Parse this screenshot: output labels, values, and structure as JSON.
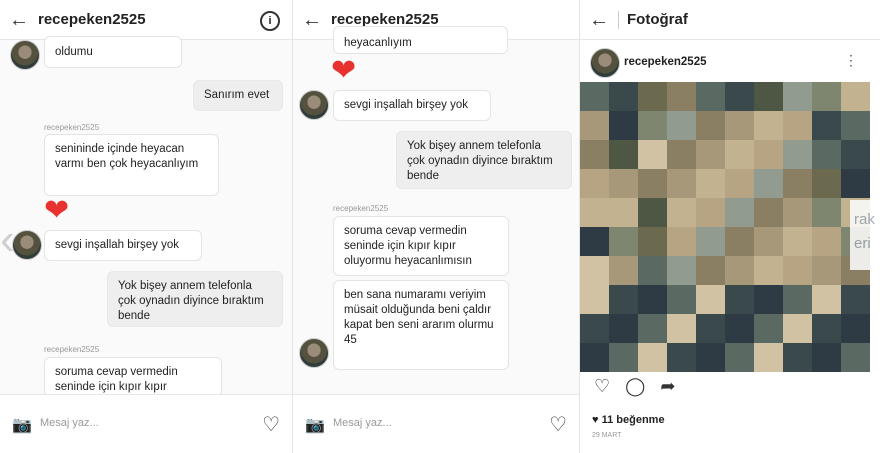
{
  "panel1": {
    "header": {
      "title": "recepeken2525"
    },
    "messages": [
      {
        "text": "oldumu"
      },
      {
        "text": "Sanırım evet"
      },
      {
        "username": "recepeken2525"
      },
      {
        "text": "senininde içinde heyacan varmı ben çok heyacanlıyım"
      },
      {
        "text": "sevgi inşallah birşey yok"
      },
      {
        "text": "Yok bişey annem telefonla çok oynadın diyince bıraktım bende"
      },
      {
        "username": "recepeken2525"
      },
      {
        "text": "soruma cevap vermedin seninde için kıpır kıpır"
      }
    ],
    "composer": {
      "placeholder": "Mesaj yaz..."
    }
  },
  "panel2": {
    "header": {
      "title": "recepeken2525"
    },
    "messages": [
      {
        "text": "heyacanlıyım"
      },
      {
        "text": "sevgi inşallah birşey yok"
      },
      {
        "text": "Yok bişey annem telefonla çok oynadın diyince bıraktım bende"
      },
      {
        "username": "recepeken2525"
      },
      {
        "text": "soruma cevap vermedin seninde için kıpır kıpır oluyormu heyacanlımısın"
      },
      {
        "text": "ben sana numaramı veriyim müsait olduğunda beni çaldır kapat ben seni ararım olurmu 45"
      }
    ],
    "composer": {
      "placeholder": "Mesaj yaz..."
    }
  },
  "panel3": {
    "header": {
      "title": "Fotoğraf"
    },
    "post": {
      "username": "recepeken2525",
      "likes": "11 beğenme",
      "date": "29 MART"
    },
    "edge_text": [
      "rak",
      "eri"
    ]
  },
  "colors": {
    "heart": "#e8322f",
    "bubble_out": "#eeeeee",
    "bubble_in": "#ffffff"
  },
  "icons": [
    "back-arrow-icon",
    "info-icon",
    "camera-icon",
    "heart-icon",
    "comment-icon",
    "share-icon",
    "more-icon"
  ]
}
